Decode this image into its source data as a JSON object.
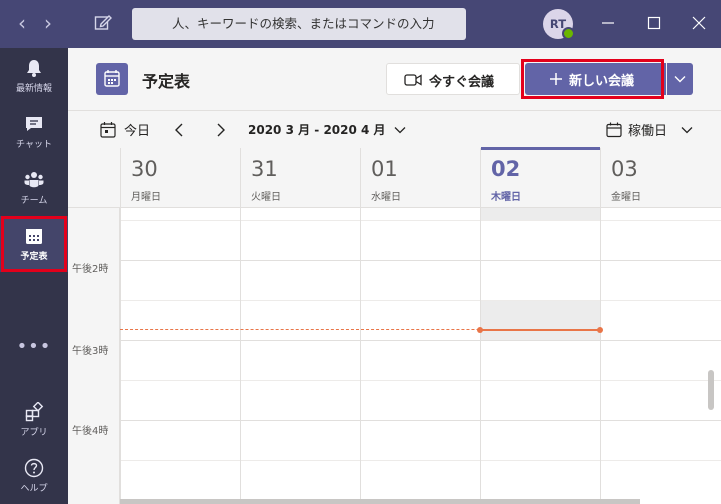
{
  "titlebar": {
    "search_placeholder": "人、キーワードの検索、またはコマンドの入力",
    "avatar_initials": "RT",
    "back_glyph": "‹",
    "forward_glyph": "›"
  },
  "rail": {
    "items": [
      {
        "label": "最新情報",
        "icon": "bell-icon"
      },
      {
        "label": "チャット",
        "icon": "chat-icon"
      },
      {
        "label": "チーム",
        "icon": "teams-icon"
      },
      {
        "label": "予定表",
        "icon": "calendar-icon",
        "active": true
      },
      {
        "label": "アプリ",
        "icon": "apps-icon"
      },
      {
        "label": "ヘルプ",
        "icon": "help-icon"
      }
    ],
    "more": "•••"
  },
  "header": {
    "title": "予定表",
    "meet_now": "今すぐ会議",
    "new_meeting": "新しい会議"
  },
  "toolbar": {
    "today": "今日",
    "range": "2020 3 月 - 2020 4 月",
    "view": "稼働日"
  },
  "days": [
    {
      "num": "30",
      "name": "月曜日"
    },
    {
      "num": "31",
      "name": "火曜日"
    },
    {
      "num": "01",
      "name": "水曜日"
    },
    {
      "num": "02",
      "name": "木曜日",
      "today": true
    },
    {
      "num": "03",
      "name": "金曜日"
    }
  ],
  "times": [
    "午後2時",
    "午後3時",
    "午後4時"
  ],
  "colors": {
    "titlebar": "#464775",
    "rail": "#33344a",
    "accent": "#6264a7",
    "highlight": "#e3001b",
    "now": "#e97548"
  }
}
